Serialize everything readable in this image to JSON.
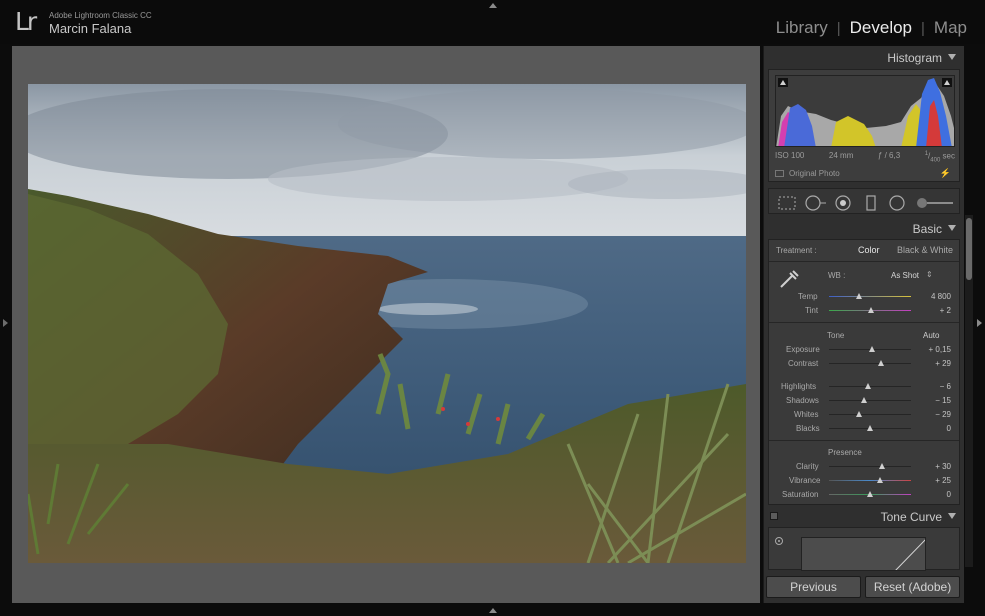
{
  "app": {
    "logo": "Lr",
    "title": "Adobe Lightroom Classic CC",
    "user": "Marcin Falana"
  },
  "modules": [
    {
      "label": "Library",
      "active": false
    },
    {
      "label": "Develop",
      "active": true
    },
    {
      "label": "Map",
      "active": false
    }
  ],
  "histogram": {
    "title": "Histogram",
    "iso": "ISO 100",
    "focal": "24 mm",
    "aperture": "ƒ / 6,3",
    "shutter_num": "1",
    "shutter_den": "400",
    "shutter_unit": "sec",
    "original_photo": "Original Photo"
  },
  "tools": [
    "crop-overlay-icon",
    "spot-removal-icon",
    "red-eye-icon",
    "graduated-filter-icon",
    "radial-filter-icon",
    "adjustment-brush-icon"
  ],
  "basic": {
    "title": "Basic",
    "treatment_label": "Treatment :",
    "treatment_color": "Color",
    "treatment_bw": "Black & White",
    "wb_label": "WB :",
    "wb_value": "As Shot",
    "tone_title": "Tone",
    "tone_auto": "Auto",
    "presence_title": "Presence",
    "sliders": {
      "temp": {
        "label": "Temp",
        "value": "4 800",
        "pos": 0.36
      },
      "tint": {
        "label": "Tint",
        "value": "+ 2",
        "pos": 0.51
      },
      "exposure": {
        "label": "Exposure",
        "value": "+ 0,15",
        "pos": 0.52
      },
      "contrast": {
        "label": "Contrast",
        "value": "+ 29",
        "pos": 0.64
      },
      "highlights": {
        "label": "Highlights",
        "value": "− 6",
        "pos": 0.47
      },
      "shadows": {
        "label": "Shadows",
        "value": "− 15",
        "pos": 0.43
      },
      "whites": {
        "label": "Whites",
        "value": "− 29",
        "pos": 0.36
      },
      "blacks": {
        "label": "Blacks",
        "value": "0",
        "pos": 0.5
      },
      "clarity": {
        "label": "Clarity",
        "value": "+ 30",
        "pos": 0.65
      },
      "vibrance": {
        "label": "Vibrance",
        "value": "+ 25",
        "pos": 0.62
      },
      "saturation": {
        "label": "Saturation",
        "value": "0",
        "pos": 0.5
      }
    }
  },
  "tone_curve": {
    "title": "Tone Curve"
  },
  "buttons": {
    "previous": "Previous",
    "reset": "Reset (Adobe)"
  }
}
